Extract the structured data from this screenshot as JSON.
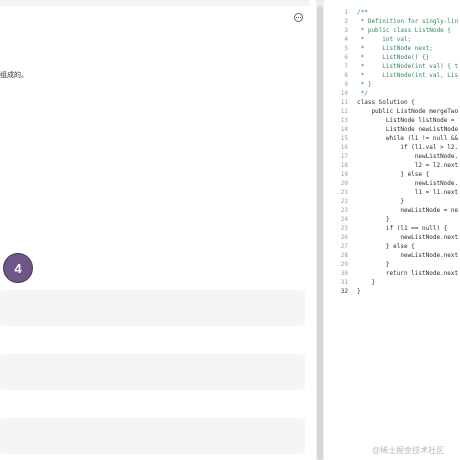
{
  "question": {
    "description_fragment": "组成的。",
    "step_number": "4"
  },
  "editor": {
    "lines": [
      {
        "num": "1",
        "code": "/**"
      },
      {
        "num": "2",
        "code": " * Definition for singly-lin"
      },
      {
        "num": "3",
        "code": " * public class ListNode {"
      },
      {
        "num": "4",
        "code": " *     int val;"
      },
      {
        "num": "5",
        "code": " *     ListNode next;"
      },
      {
        "num": "6",
        "code": " *     ListNode() {}"
      },
      {
        "num": "7",
        "code": " *     ListNode(int val) { t"
      },
      {
        "num": "8",
        "code": " *     ListNode(int val, Lis"
      },
      {
        "num": "9",
        "code": " * }"
      },
      {
        "num": "10",
        "code": " */"
      },
      {
        "num": "11",
        "code": "class Solution {"
      },
      {
        "num": "12",
        "code": "    public ListNode mergeTwo"
      },
      {
        "num": "13",
        "code": "        ListNode listNode ="
      },
      {
        "num": "14",
        "code": "        ListNode newListNode"
      },
      {
        "num": "15",
        "code": "        while (l1 != null &&"
      },
      {
        "num": "16",
        "code": "            if (l1.val > l2."
      },
      {
        "num": "17",
        "code": "                newListNode."
      },
      {
        "num": "18",
        "code": "                l2 = l2.next"
      },
      {
        "num": "19",
        "code": "            } else {"
      },
      {
        "num": "20",
        "code": "                newListNode."
      },
      {
        "num": "21",
        "code": "                l1 = l1.next"
      },
      {
        "num": "22",
        "code": "            }"
      },
      {
        "num": "23",
        "code": "            newListNode = ne"
      },
      {
        "num": "24",
        "code": "        }"
      },
      {
        "num": "25",
        "code": "        if (l1 == null) {"
      },
      {
        "num": "26",
        "code": "            newListNode.next"
      },
      {
        "num": "27",
        "code": "        } else {"
      },
      {
        "num": "28",
        "code": "            newListNode.next"
      },
      {
        "num": "29",
        "code": "        }"
      },
      {
        "num": "30",
        "code": "        return listNode.next"
      },
      {
        "num": "31",
        "code": "    }"
      },
      {
        "num": "32",
        "code": "}"
      }
    ]
  },
  "watermark": "@稀土掘金技术社区",
  "colors": {
    "step_badge": "#6e5689",
    "comment": "#2e8b57",
    "keyword": "#0000ff",
    "type": "#267f99"
  }
}
